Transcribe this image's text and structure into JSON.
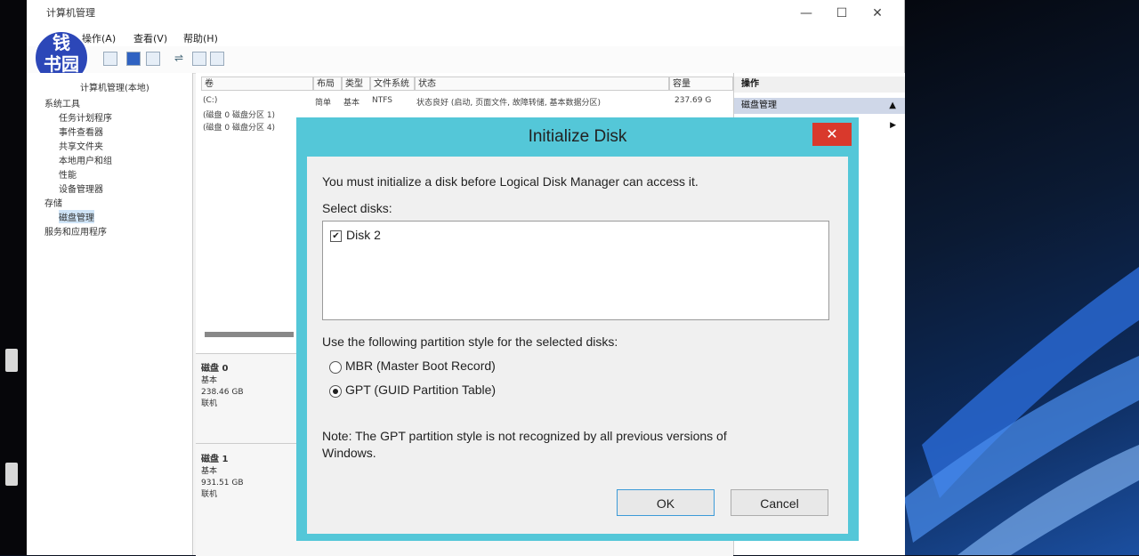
{
  "main_window": {
    "title": "计算机管理",
    "menu": [
      "操作(A)",
      "查看(V)",
      "帮助(H)"
    ],
    "controls": {
      "minimize": "—",
      "maximize": "☐",
      "close": "✕"
    },
    "badge": [
      "钱",
      "书园"
    ]
  },
  "tree": {
    "items": [
      {
        "label": "计算机管理(本地)"
      },
      {
        "label": "系统工具"
      },
      {
        "label": "任务计划程序"
      },
      {
        "label": "事件查看器"
      },
      {
        "label": "共享文件夹"
      },
      {
        "label": "本地用户和组"
      },
      {
        "label": "性能"
      },
      {
        "label": "设备管理器"
      },
      {
        "label": "存储"
      },
      {
        "label": "磁盘管理"
      },
      {
        "label": "服务和应用程序"
      }
    ]
  },
  "volume_table": {
    "headers": [
      "卷",
      "布局",
      "类型",
      "文件系统",
      "状态",
      "容量"
    ],
    "rows": [
      {
        "volume": "(C:)",
        "layout": "简单",
        "type": "基本",
        "fs": "NTFS",
        "status": "状态良好 (启动, 页面文件, 故障转储, 基本数据分区)",
        "capacity": "237.69 G"
      },
      {
        "volume": "(磁盘 0 磁盘分区 1)",
        "layout": "",
        "type": "",
        "fs": "",
        "status": "",
        "capacity": ""
      },
      {
        "volume": "(磁盘 0 磁盘分区 4)",
        "layout": "",
        "type": "",
        "fs": "",
        "status": "",
        "capacity": ""
      }
    ]
  },
  "disks": [
    {
      "name": "磁盘 0",
      "type": "基本",
      "size": "238.46 GB",
      "state": "联机"
    },
    {
      "name": "磁盘 1",
      "type": "基本",
      "size": "931.51 GB",
      "state": "联机"
    }
  ],
  "actions": {
    "header": "操作",
    "item": "磁盘管理"
  },
  "dialog": {
    "title": "Initialize Disk",
    "close": "✕",
    "intro": "You must initialize a disk before Logical Disk Manager can access it.",
    "select_label": "Select disks:",
    "disk_item": "Disk 2",
    "disk_checked": true,
    "style_label": "Use the following partition style for the selected disks:",
    "mbr_label": "MBR (Master Boot Record)",
    "gpt_label": "GPT (GUID Partition Table)",
    "selected_style": "GPT",
    "note_line1": "Note:  The GPT partition style is not recognized by all previous versions of",
    "note_line2": "Windows.",
    "ok": "OK",
    "cancel": "Cancel"
  },
  "colors": {
    "dialog_frame": "#54c7d8",
    "close_red": "#d9392c",
    "badge_blue": "#2c47b8"
  }
}
